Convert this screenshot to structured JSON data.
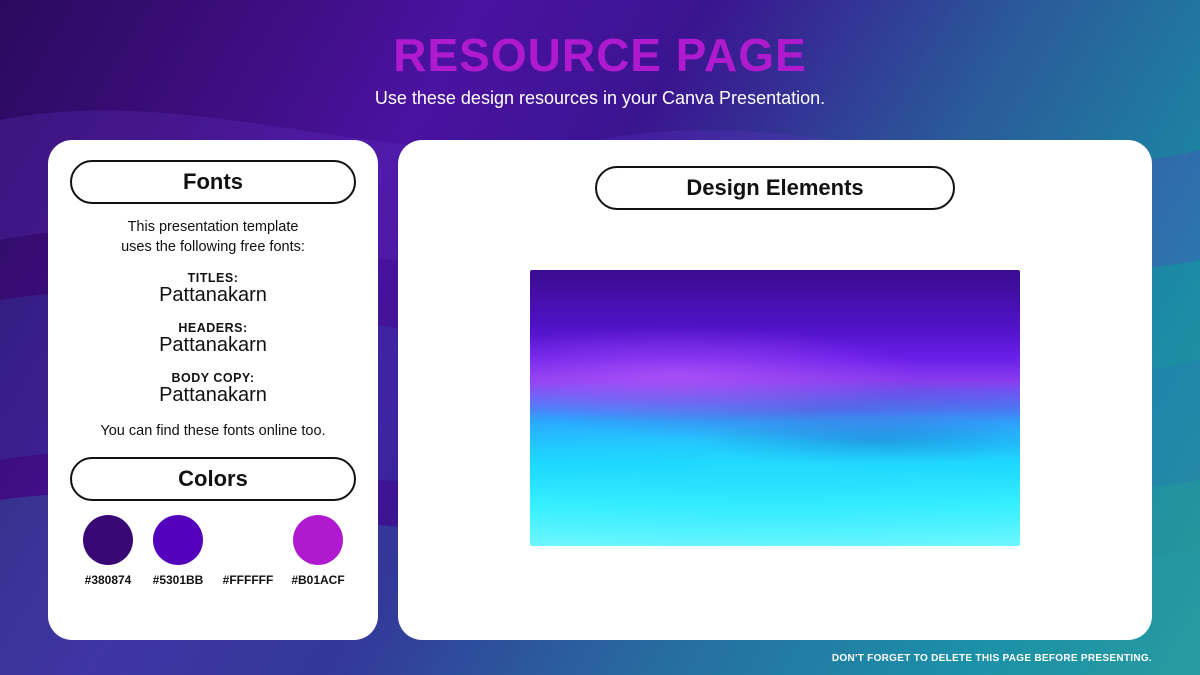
{
  "header": {
    "title": "RESOURCE PAGE",
    "subtitle": "Use these design resources in your Canva Presentation."
  },
  "fonts": {
    "heading": "Fonts",
    "intro_line1": "This presentation template",
    "intro_line2": "uses the following free fonts:",
    "groups": [
      {
        "label": "TITLES:",
        "name": "Pattanakarn"
      },
      {
        "label": "HEADERS:",
        "name": "Pattanakarn"
      },
      {
        "label": "BODY COPY:",
        "name": "Pattanakarn"
      }
    ],
    "outro": "You can find these fonts online too."
  },
  "colors": {
    "heading": "Colors",
    "swatches": [
      {
        "hex": "#380874"
      },
      {
        "hex": "#5301BB"
      },
      {
        "hex": "#FFFFFF"
      },
      {
        "hex": "#B01ACF"
      }
    ]
  },
  "elements": {
    "heading": "Design Elements"
  },
  "footer": {
    "note": "DON'T FORGET TO DELETE THIS PAGE BEFORE PRESENTING."
  }
}
